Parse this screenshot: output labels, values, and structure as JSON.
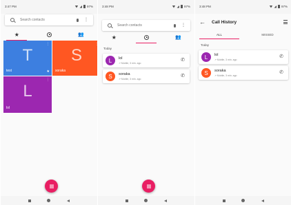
{
  "screen_favorites": {
    "status": {
      "time": "3:47 PM",
      "battery": "97%"
    },
    "search": {
      "placeholder": "Search contacts"
    },
    "tiles": [
      {
        "letter": "T",
        "name": "test",
        "color": "#3d7fe0"
      },
      {
        "letter": "S",
        "name": "soraka",
        "color": "#ff5722"
      },
      {
        "letter": "L",
        "name": "lol",
        "color": "#9c27b0"
      }
    ],
    "more_glyph": "⋮",
    "star_glyph": "★"
  },
  "screen_recents": {
    "status": {
      "time": "3:48 PM",
      "battery": "97%"
    },
    "search": {
      "placeholder": "Search contacts"
    },
    "section": "Today",
    "calls": [
      {
        "letter": "L",
        "name": "lol",
        "sub": "↗ Mobile, 3 min. ago",
        "color": "#9c27b0"
      },
      {
        "letter": "S",
        "name": "soraka",
        "sub": "↗ Mobile, 3 min. ago",
        "color": "#ff5722"
      }
    ]
  },
  "screen_history": {
    "status": {
      "time": "3:48 PM",
      "battery": "97%"
    },
    "title": "Call History",
    "tabs": [
      "ALL",
      "MISSED"
    ],
    "section": "Today",
    "calls": [
      {
        "letter": "L",
        "name": "lol",
        "sub": "↗ Mobile, 3 min. ago",
        "color": "#9c27b0"
      },
      {
        "letter": "S",
        "name": "soraka",
        "sub": "↗ Mobile, 3 min. ago",
        "color": "#ff5722"
      }
    ]
  },
  "colors": {
    "accent": "#e91e63"
  },
  "glyphs": {
    "back": "←",
    "phone": "✆",
    "people": "👥",
    "star": "★",
    "menu": "⋮"
  }
}
